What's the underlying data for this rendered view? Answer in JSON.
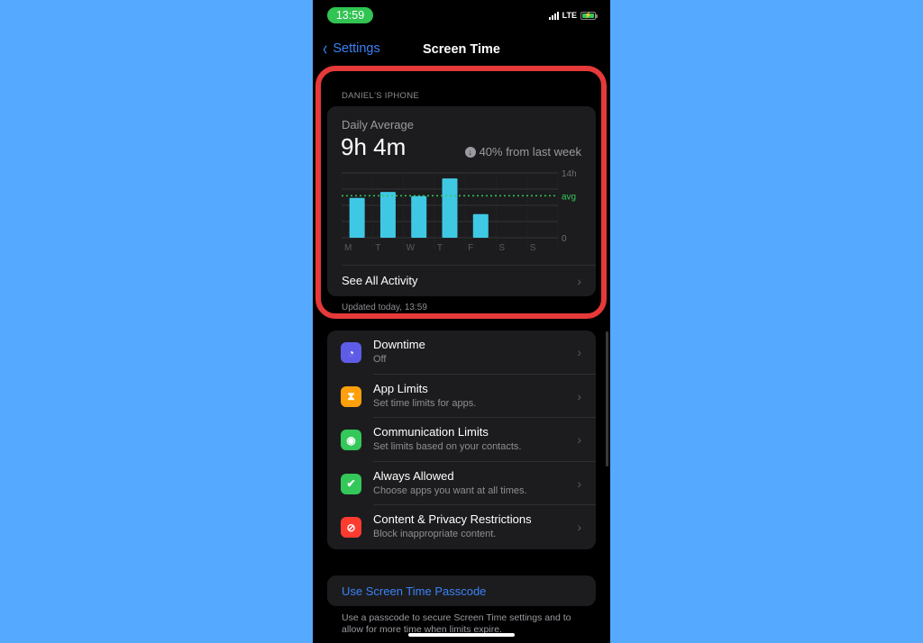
{
  "status_bar": {
    "time": "13:59",
    "network": "LTE",
    "battery_charging": true
  },
  "nav": {
    "back_label": "Settings",
    "title": "Screen Time"
  },
  "device_section": {
    "header": "DANIEL'S IPHONE",
    "daily_average_label": "Daily Average",
    "daily_average_value": "9h 4m",
    "change_text": "40% from last week",
    "change_direction": "down",
    "see_all_label": "See All Activity",
    "updated_text": "Updated today, 13:59"
  },
  "chart_data": {
    "type": "bar",
    "categories": [
      "M",
      "T",
      "W",
      "T",
      "F",
      "S",
      "S"
    ],
    "values": [
      8.6,
      9.9,
      9.0,
      12.8,
      5.1,
      0,
      0
    ],
    "unit": "hours",
    "ylim": [
      0,
      14
    ],
    "y_tick_labels": [
      "14h",
      "0"
    ],
    "average": 9.07,
    "average_label": "avg",
    "bar_color": "#3fc8e4",
    "avg_color": "#34c759",
    "grid": true
  },
  "settings_list": [
    {
      "title": "Downtime",
      "subtitle": "Off",
      "icon": "downtime-icon",
      "icon_glyph": "◔",
      "color": "#5e5ce6"
    },
    {
      "title": "App Limits",
      "subtitle": "Set time limits for apps.",
      "icon": "hourglass-icon",
      "icon_glyph": "⧗",
      "color": "#ff9f0a"
    },
    {
      "title": "Communication Limits",
      "subtitle": "Set limits based on your contacts.",
      "icon": "contact-icon",
      "icon_glyph": "◉",
      "color": "#34c759"
    },
    {
      "title": "Always Allowed",
      "subtitle": "Choose apps you want at all times.",
      "icon": "checkmark-seal-icon",
      "icon_glyph": "✔",
      "color": "#34c759"
    },
    {
      "title": "Content & Privacy Restrictions",
      "subtitle": "Block inappropriate content.",
      "icon": "restriction-icon",
      "icon_glyph": "⊘",
      "color": "#ff3b30"
    }
  ],
  "passcode": {
    "label": "Use Screen Time Passcode",
    "footnote": "Use a passcode to secure Screen Time settings and to allow for more time when limits expire."
  },
  "colors": {
    "accent": "#3b82f6",
    "highlight": "#e5393a",
    "background": "#55aaff"
  }
}
